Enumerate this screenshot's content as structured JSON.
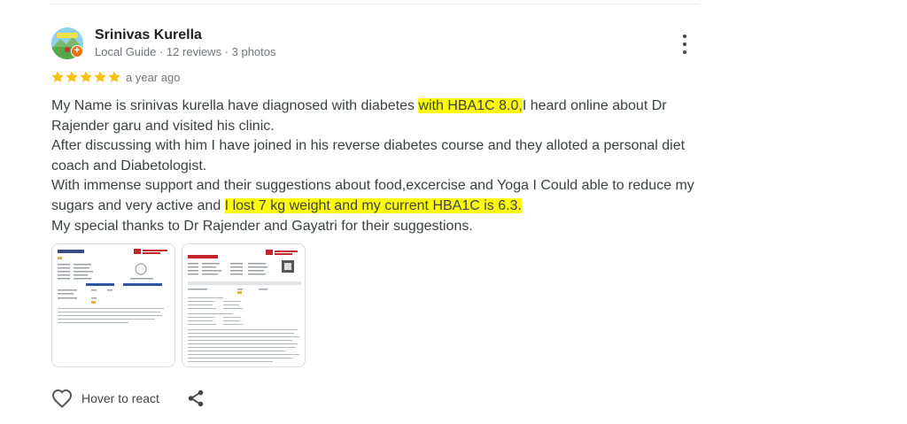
{
  "reviewer": {
    "name": "Srinivas Kurella",
    "meta": "Local Guide · 12 reviews · 3 photos",
    "badge_icon": "local-guide-badge"
  },
  "rating": {
    "stars": 5,
    "max": 5,
    "color": "#fbbc04"
  },
  "review_age": "a year ago",
  "review": {
    "p1_before": "My Name is srinivas kurella have diagnosed with diabetes ",
    "p1_highlight": "with HBA1C 8.0,",
    "p1_after": "I heard online about Dr Rajender garu and visited his clinic.",
    "p2": "After discussing with him I have joined in his reverse diabetes course and they alloted a personal diet coach and Diabetologist.",
    "p3_before": "With immense support and their suggestions about food,excercise and Yoga I Could able to reduce my sugars and very active and ",
    "p3_highlight": "I lost 7 kg weight and my current HBA1C is 6.3.",
    "p4": "My special thanks to Dr Rajender and Gayatri for their suggestions.",
    "highlight_color": "#ffff00"
  },
  "photos": {
    "count": 2
  },
  "actions": {
    "react_label": "Hover to react",
    "react_icon": "heart-outline-icon",
    "share_icon": "share-icon",
    "more_icon": "more-vert-icon"
  }
}
